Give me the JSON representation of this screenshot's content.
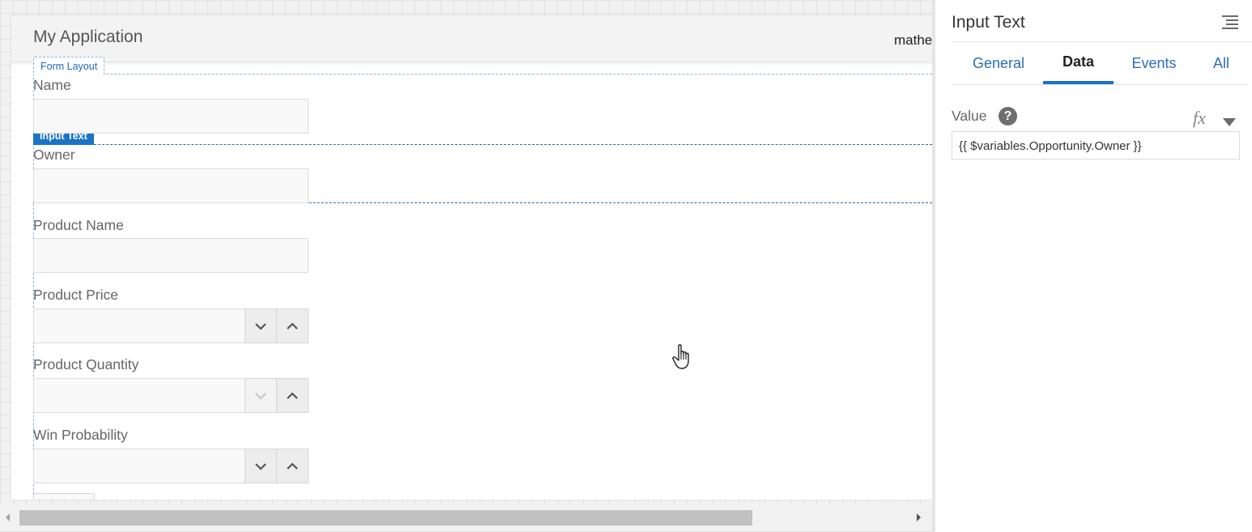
{
  "canvas": {
    "app_title": "My Application",
    "user_name": "mathe",
    "form_layout_tag": "Form Layout",
    "selected_component_tag": "Input Text",
    "fields": [
      {
        "label": "Name",
        "kind": "text"
      },
      {
        "label": "Owner",
        "kind": "text"
      },
      {
        "label": "Product Name",
        "kind": "text"
      },
      {
        "label": "Product Price",
        "kind": "number"
      },
      {
        "label": "Product Quantity",
        "kind": "number"
      },
      {
        "label": "Win Probability",
        "kind": "number"
      }
    ]
  },
  "panel": {
    "title": "Input Text",
    "tabs": [
      {
        "label": "General",
        "active": false
      },
      {
        "label": "Data",
        "active": true
      },
      {
        "label": "Events",
        "active": false
      },
      {
        "label": "All",
        "active": false
      }
    ],
    "value_label": "Value",
    "help_glyph": "?",
    "fx_label": "fx",
    "value_expression": "{{ $variables.Opportunity.Owner }}"
  },
  "colors": {
    "accent": "#1a73c7",
    "link": "#2a6ebb"
  }
}
